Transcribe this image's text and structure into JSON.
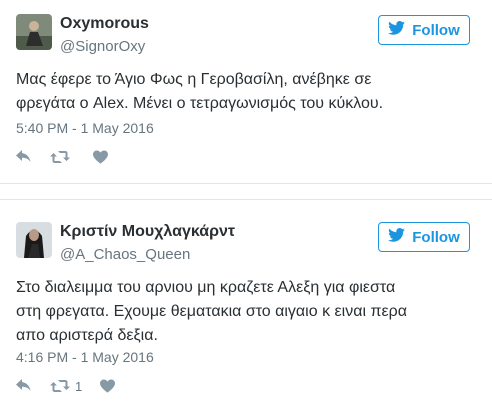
{
  "colors": {
    "accent": "#1b95e0",
    "text": "#292f33",
    "muted": "#66757f",
    "icon": "#8899a6",
    "divider": "#e1e8ed"
  },
  "tweets": [
    {
      "name": "Oxymorous",
      "handle": "@SignorOxy",
      "follow_label": "Follow",
      "lines": [
        "Μας έφερε το Άγιο Φως η Γεροβασίλη, ανέβηκε σε",
        "φρεγάτα ο Alex. Μένει ο τετραγωνισμός του κύκλου."
      ],
      "time": "5:40 PM - 1 May 2016",
      "actions": {
        "reply_icon": "reply-icon",
        "retweet_icon": "retweet-icon",
        "like_icon": "heart-icon",
        "retweet_count": ""
      }
    },
    {
      "name": "Κριστίν Μουχλαγκάρντ",
      "handle": "@A_Chaos_Queen",
      "follow_label": "Follow",
      "lines": [
        "Στο διαλειμμα του αρνιου μη κραζετε Αλεξη για φιεστα",
        "στη φρεγατα. Εχουμε θεματακια στο αιγαιο κ ειναι περα",
        "απο αριστερά δεξια."
      ],
      "time": "4:16 PM - 1 May 2016",
      "actions": {
        "reply_icon": "reply-icon",
        "retweet_icon": "retweet-icon",
        "like_icon": "heart-icon",
        "retweet_count": "1"
      }
    }
  ]
}
